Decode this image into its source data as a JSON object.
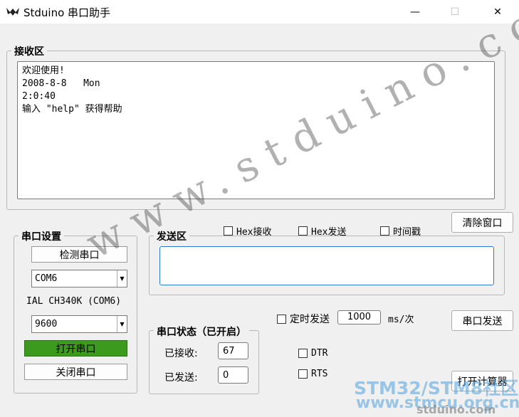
{
  "window": {
    "title": "Stduino 串口助手",
    "controls": {
      "minimize": "—",
      "maximize": "☐",
      "close": "✕"
    }
  },
  "receive": {
    "legend": "接收区",
    "lines": [
      "欢迎使用!",
      "2008-8-8   Mon",
      "2:0:40",
      "输入 \"help\" 获得帮助"
    ]
  },
  "options": {
    "hex_recv": "Hex接收",
    "hex_send": "Hex发送",
    "timestamp": "时间戳",
    "clear_button": "清除窗口"
  },
  "serial_settings": {
    "legend": "串口设置",
    "detect_button": "检测串口",
    "port_value": "COM6",
    "device_label": "IAL CH340K (COM6)",
    "baud_value": "9600",
    "open_button": "打开串口",
    "close_button": "关闭串口",
    "open_button_color": "#3c9a1f"
  },
  "send": {
    "legend": "发送区",
    "value": "",
    "timed_send_label": "定时发送",
    "interval_value": "1000",
    "interval_unit": "ms/次",
    "send_button": "串口发送"
  },
  "status": {
    "legend": "串口状态（已开启）",
    "received_label": "已接收:",
    "received_value": "67",
    "sent_label": "已发送:",
    "sent_value": "0"
  },
  "signals": {
    "dtr": "DTR",
    "rts": "RTS"
  },
  "calculator_button": "打开计算器",
  "watermark": {
    "diagonal": "www.stduino.com",
    "line1": "STM32/STM8社区",
    "line2": "www.stmcu.org.cn",
    "line3": "stduino.com"
  }
}
